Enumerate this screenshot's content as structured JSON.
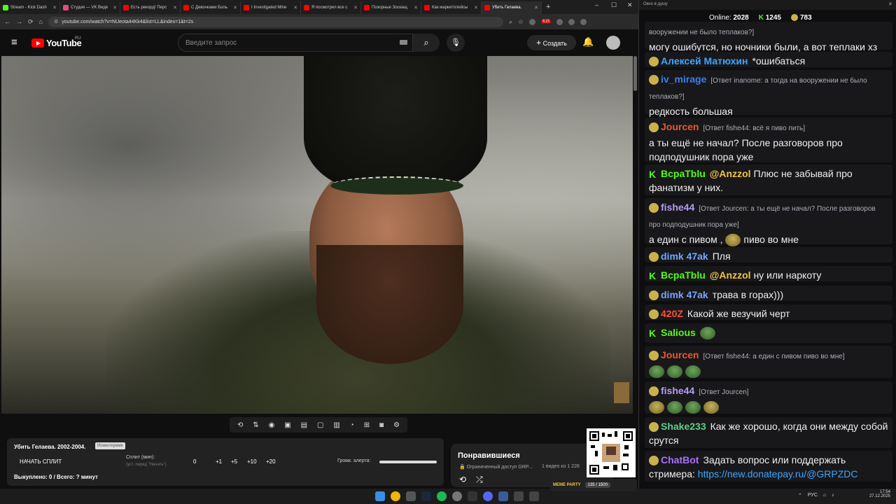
{
  "browser": {
    "tabs": [
      {
        "title": "Stream - Kick Dash",
        "color": "#53fc18"
      },
      {
        "title": "Студия — VK Виде",
        "color": "#e84a7f"
      },
      {
        "title": "Есть рекорд! Перс",
        "color": "#ff0000"
      },
      {
        "title": "С Девочками Боль",
        "color": "#ff0000"
      },
      {
        "title": "I Investigated Mine",
        "color": "#ff0000"
      },
      {
        "title": "Я посмотрел все с",
        "color": "#ff0000"
      },
      {
        "title": "Позорные Зоозащ",
        "color": "#ff0000"
      },
      {
        "title": "Как маркетплейсы",
        "color": "#ff0000"
      },
      {
        "title": "Убить Гелаева.",
        "color": "#ff0000"
      }
    ],
    "url": "youtube.com/watch?v=NUeota44Kk4&list=LL&index=1&t=2s",
    "badge_count": "615"
  },
  "youtube": {
    "logo_text": "YouTube",
    "logo_region": "RU",
    "search_placeholder": "Введите запрос",
    "create_label": "Создать"
  },
  "widget": {
    "title": "Убить Гелаева. 2002-2004.",
    "tag": "Искинтеремв",
    "start_split": "НАЧАТЬ СПЛИТ",
    "split_label": "Сплит (мин):",
    "split_hint": "(уст. перед \"Начать\")",
    "split_value": "0",
    "increments": [
      "+1",
      "+5",
      "+10",
      "+20"
    ],
    "volume_label": "Громк. алерта:",
    "status": "Выкуплено: 0 / Всего: ? минут"
  },
  "liked": {
    "title": "Понравившиеся",
    "access": "Ограниченный доступ GRP...",
    "count": "1 видео из 1 226"
  },
  "chat": {
    "window_title": "Окно в душу",
    "online_label": "Online:",
    "online_value": "2028",
    "kick_count": "1245",
    "badge_count": "783",
    "messages": [
      {
        "text_top": "вооружении не было теплаков?]",
        "text": "могу ошибутся, но ночники были, а вот теплаки хз"
      },
      {
        "nick": "Алексей Матюхин",
        "text": "*ошибаться"
      },
      {
        "nick": "iv_mirage",
        "reply": "[Ответ inanome: а тогда на вооружении не было теплаков?]",
        "text": "редкость большая"
      },
      {
        "nick": "Jourcen",
        "reply": "[Ответ fishe44: всё я пиво пить]",
        "text": "а ты ещё не начал? После разговоров про подподушник пора уже"
      },
      {
        "nick": "BcpaTblu",
        "mention": "@Anzzol",
        "text": "Плюс не забывай про фанатизм у них."
      },
      {
        "nick": "fishe44",
        "reply": "[Ответ Jourcen: а ты ещё не начал? После разговоров про подподушник пора уже]",
        "text": "а един с пивом ,",
        "text2": "пиво во мне"
      },
      {
        "nick": "dimk 47ak",
        "text": "Пля"
      },
      {
        "nick": "BcpaTblu",
        "mention": "@Anzzol",
        "text": "ну или наркоту"
      },
      {
        "nick": "dimk 47ak",
        "text": "трава в горах)))"
      },
      {
        "nick": "420Z",
        "text": "Какой же везучий черт"
      },
      {
        "nick": "Salious",
        "text": ""
      },
      {
        "nick": "Jourcen",
        "reply": "[Ответ fishe44: а един с пивом  пиво во мне]",
        "text": ""
      },
      {
        "nick": "fishe44",
        "reply": "[Ответ Jourcen]",
        "text": ""
      },
      {
        "nick": "Shake233",
        "text": "Как же хорошо, когда они между собой срутся"
      },
      {
        "nick": "ChatBot",
        "text": "Задать вопрос или поддержать стримера:",
        "link": "https://new.donatepay.ru/@GRPZDC"
      }
    ],
    "nick_colors": {
      "Алексей Матюхин": "#3ea6ff",
      "iv_mirage": "#3e7ee8",
      "Jourcen": "#e8582e",
      "BcpaTblu": "#53fc18",
      "fishe44": "#b59cf5",
      "dimk 47ak": "#74a6ff",
      "420Z": "#ff4f3a",
      "Salious": "#53fc18",
      "Shake233": "#5fcf8a",
      "ChatBot": "#a970ff"
    }
  },
  "qr_overlay": {
    "label": "MEME PARTY",
    "progress": "135 / 1500"
  },
  "taskbar": {
    "lang": "РУС",
    "time": "17:54",
    "date": "27.12.2025"
  }
}
